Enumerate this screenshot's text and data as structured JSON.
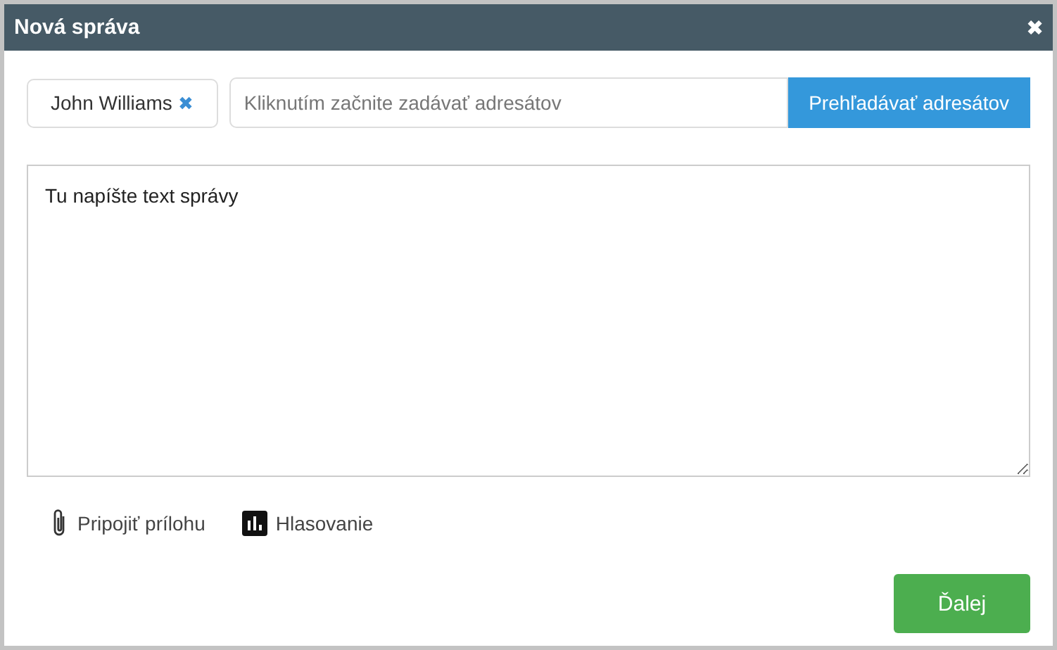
{
  "window": {
    "title": "Nová správa",
    "close": "✖"
  },
  "recipients": [
    {
      "name": "John Williams",
      "remove": "✖"
    }
  ],
  "recipient_search": {
    "placeholder": "Kliknutím začnite zadávať adresátov"
  },
  "browse_button": "Prehľadávať adresátov",
  "message": {
    "placeholder": "Tu napíšte text správy"
  },
  "actions": [
    {
      "kind": "attach",
      "label": "Pripojiť prílohu"
    },
    {
      "kind": "poll",
      "label": "Hlasovanie"
    }
  ],
  "next_button": "Ďalej"
}
